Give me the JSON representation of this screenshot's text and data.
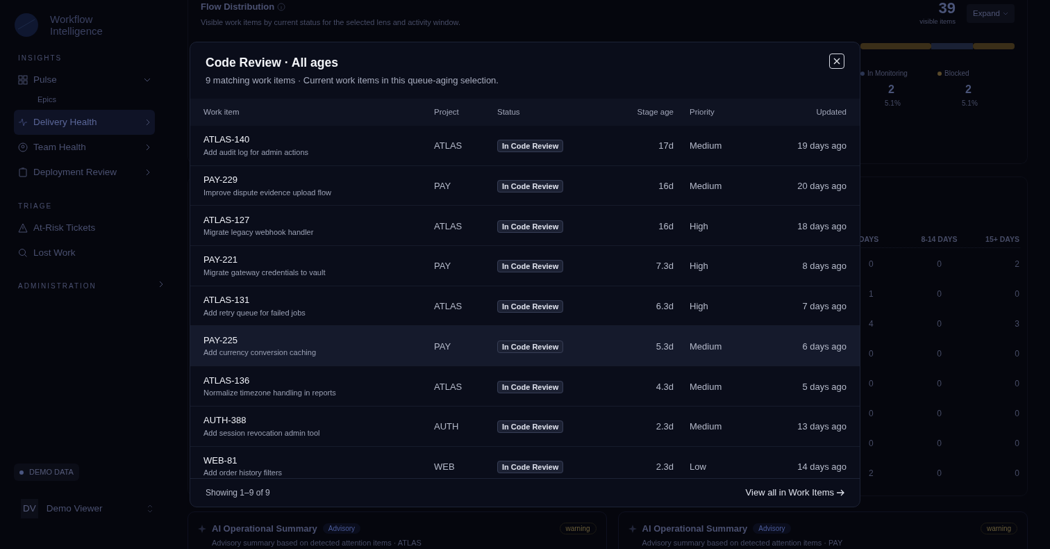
{
  "sidebar": {
    "brand": "Workflow Intelligence",
    "sections": [
      {
        "label": "INSIGHTS",
        "items": [
          {
            "label": "Pulse",
            "selected": false,
            "expanded": true,
            "children": [
              {
                "label": "Epics",
                "selected": false
              }
            ]
          },
          {
            "label": "Delivery Health",
            "selected": true,
            "expanded": false
          },
          {
            "label": "Team Health",
            "selected": false,
            "expanded": false
          },
          {
            "label": "Deployment Review",
            "selected": false,
            "expanded": false
          }
        ]
      },
      {
        "label": "TRIAGE",
        "items": [
          {
            "label": "At-Risk Tickets",
            "selected": false
          },
          {
            "label": "Lost Work",
            "selected": false
          }
        ]
      },
      {
        "label": "ADMINISTRATION",
        "expanded": false
      }
    ],
    "demo_badge": "DEMO DATA",
    "user": {
      "initials": "DV",
      "name": "Demo Viewer"
    }
  },
  "flow_distribution": {
    "title": "Flow Distribution",
    "subtitle": "Visible work items by current status for the selected lens and activity window.",
    "count": "39",
    "count_label": "visible items",
    "expand_button": "Expand",
    "legend": [
      {
        "label": "In Monitoring",
        "value": "2",
        "percent": "5.1%",
        "color": "#2b3552"
      },
      {
        "label": "Blocked",
        "value": "2",
        "percent": "5.1%",
        "color": "#5a4a2a"
      }
    ]
  },
  "aging_table": {
    "columns": [
      "DAYS",
      "8-14 DAYS",
      "15+ DAYS"
    ],
    "rows": [
      [
        "0",
        "0",
        "2"
      ],
      [
        "1",
        "0",
        "0"
      ],
      [
        "4",
        "0",
        "3"
      ],
      [
        "0",
        "0",
        "0"
      ],
      [
        "0",
        "0",
        "0"
      ],
      [
        "0",
        "0",
        "0"
      ],
      [
        "0",
        "0",
        "0"
      ],
      [
        "2",
        "0",
        "0"
      ]
    ]
  },
  "summaries": [
    {
      "title": "AI Operational Summary",
      "tag": "Advisory",
      "status": "warning",
      "subtitle": "Advisory summary based on detected attention items · ATLAS"
    },
    {
      "title": "AI Operational Summary",
      "tag": "Advisory",
      "status": "warning",
      "subtitle": "Advisory summary based on detected attention items · PAY"
    }
  ],
  "modal": {
    "title": "Code Review · All ages",
    "subtitle": "9 matching work items · Current work items in this queue-aging selection.",
    "columns": [
      "Work item",
      "Project",
      "Status",
      "Stage age",
      "Priority",
      "Updated"
    ],
    "rows": [
      {
        "key": "ATLAS-140",
        "summary": "Add audit log for admin actions",
        "project": "ATLAS",
        "status": "In Code Review",
        "stage_age": "17d",
        "priority": "Medium",
        "updated": "19 days ago",
        "selected": false
      },
      {
        "key": "PAY-229",
        "summary": "Improve dispute evidence upload flow",
        "project": "PAY",
        "status": "In Code Review",
        "stage_age": "16d",
        "priority": "Medium",
        "updated": "20 days ago",
        "selected": false
      },
      {
        "key": "ATLAS-127",
        "summary": "Migrate legacy webhook handler",
        "project": "ATLAS",
        "status": "In Code Review",
        "stage_age": "16d",
        "priority": "High",
        "updated": "18 days ago",
        "selected": false
      },
      {
        "key": "PAY-221",
        "summary": "Migrate gateway credentials to vault",
        "project": "PAY",
        "status": "In Code Review",
        "stage_age": "7.3d",
        "priority": "High",
        "updated": "8 days ago",
        "selected": false
      },
      {
        "key": "ATLAS-131",
        "summary": "Add retry queue for failed jobs",
        "project": "ATLAS",
        "status": "In Code Review",
        "stage_age": "6.3d",
        "priority": "High",
        "updated": "7 days ago",
        "selected": false
      },
      {
        "key": "PAY-225",
        "summary": "Add currency conversion caching",
        "project": "PAY",
        "status": "In Code Review",
        "stage_age": "5.3d",
        "priority": "Medium",
        "updated": "6 days ago",
        "selected": true
      },
      {
        "key": "ATLAS-136",
        "summary": "Normalize timezone handling in reports",
        "project": "ATLAS",
        "status": "In Code Review",
        "stage_age": "4.3d",
        "priority": "Medium",
        "updated": "5 days ago",
        "selected": false
      },
      {
        "key": "AUTH-388",
        "summary": "Add session revocation admin tool",
        "project": "AUTH",
        "status": "In Code Review",
        "stage_age": "2.3d",
        "priority": "Medium",
        "updated": "13 days ago",
        "selected": false
      },
      {
        "key": "WEB-81",
        "summary": "Add order history filters",
        "project": "WEB",
        "status": "In Code Review",
        "stage_age": "2.3d",
        "priority": "Low",
        "updated": "14 days ago",
        "selected": false
      }
    ],
    "footer_count": "Showing 1–9 of 9",
    "footer_link": "View all in Work Items"
  }
}
